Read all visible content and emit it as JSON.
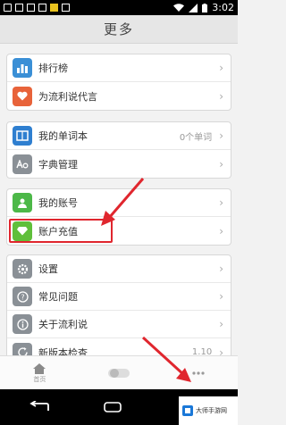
{
  "status_bar": {
    "time": "3:02"
  },
  "header": {
    "title": "更多"
  },
  "groups": [
    {
      "items": [
        {
          "label": "排行榜"
        },
        {
          "label": "为流利说代言"
        }
      ]
    },
    {
      "items": [
        {
          "label": "我的单词本",
          "value": "0个单词"
        },
        {
          "label": "字典管理"
        }
      ]
    },
    {
      "items": [
        {
          "label": "我的账号"
        },
        {
          "label": "账户充值"
        }
      ]
    },
    {
      "items": [
        {
          "label": "设置"
        },
        {
          "label": "常见问题"
        },
        {
          "label": "关于流利说"
        },
        {
          "label": "新版本检查",
          "value": "1.10"
        }
      ]
    }
  ],
  "bottom_nav": {
    "home_label": "首页"
  },
  "watermark": {
    "text": "大师手游网"
  },
  "colors": {
    "accent": "#e0262e",
    "rank": "#3a8fd6",
    "endorse": "#e8633a",
    "wordbook": "#2f7fd0",
    "dict": "#8a9096",
    "account": "#4cb848",
    "recharge": "#5fbf3a",
    "settings": "#8a9096"
  }
}
